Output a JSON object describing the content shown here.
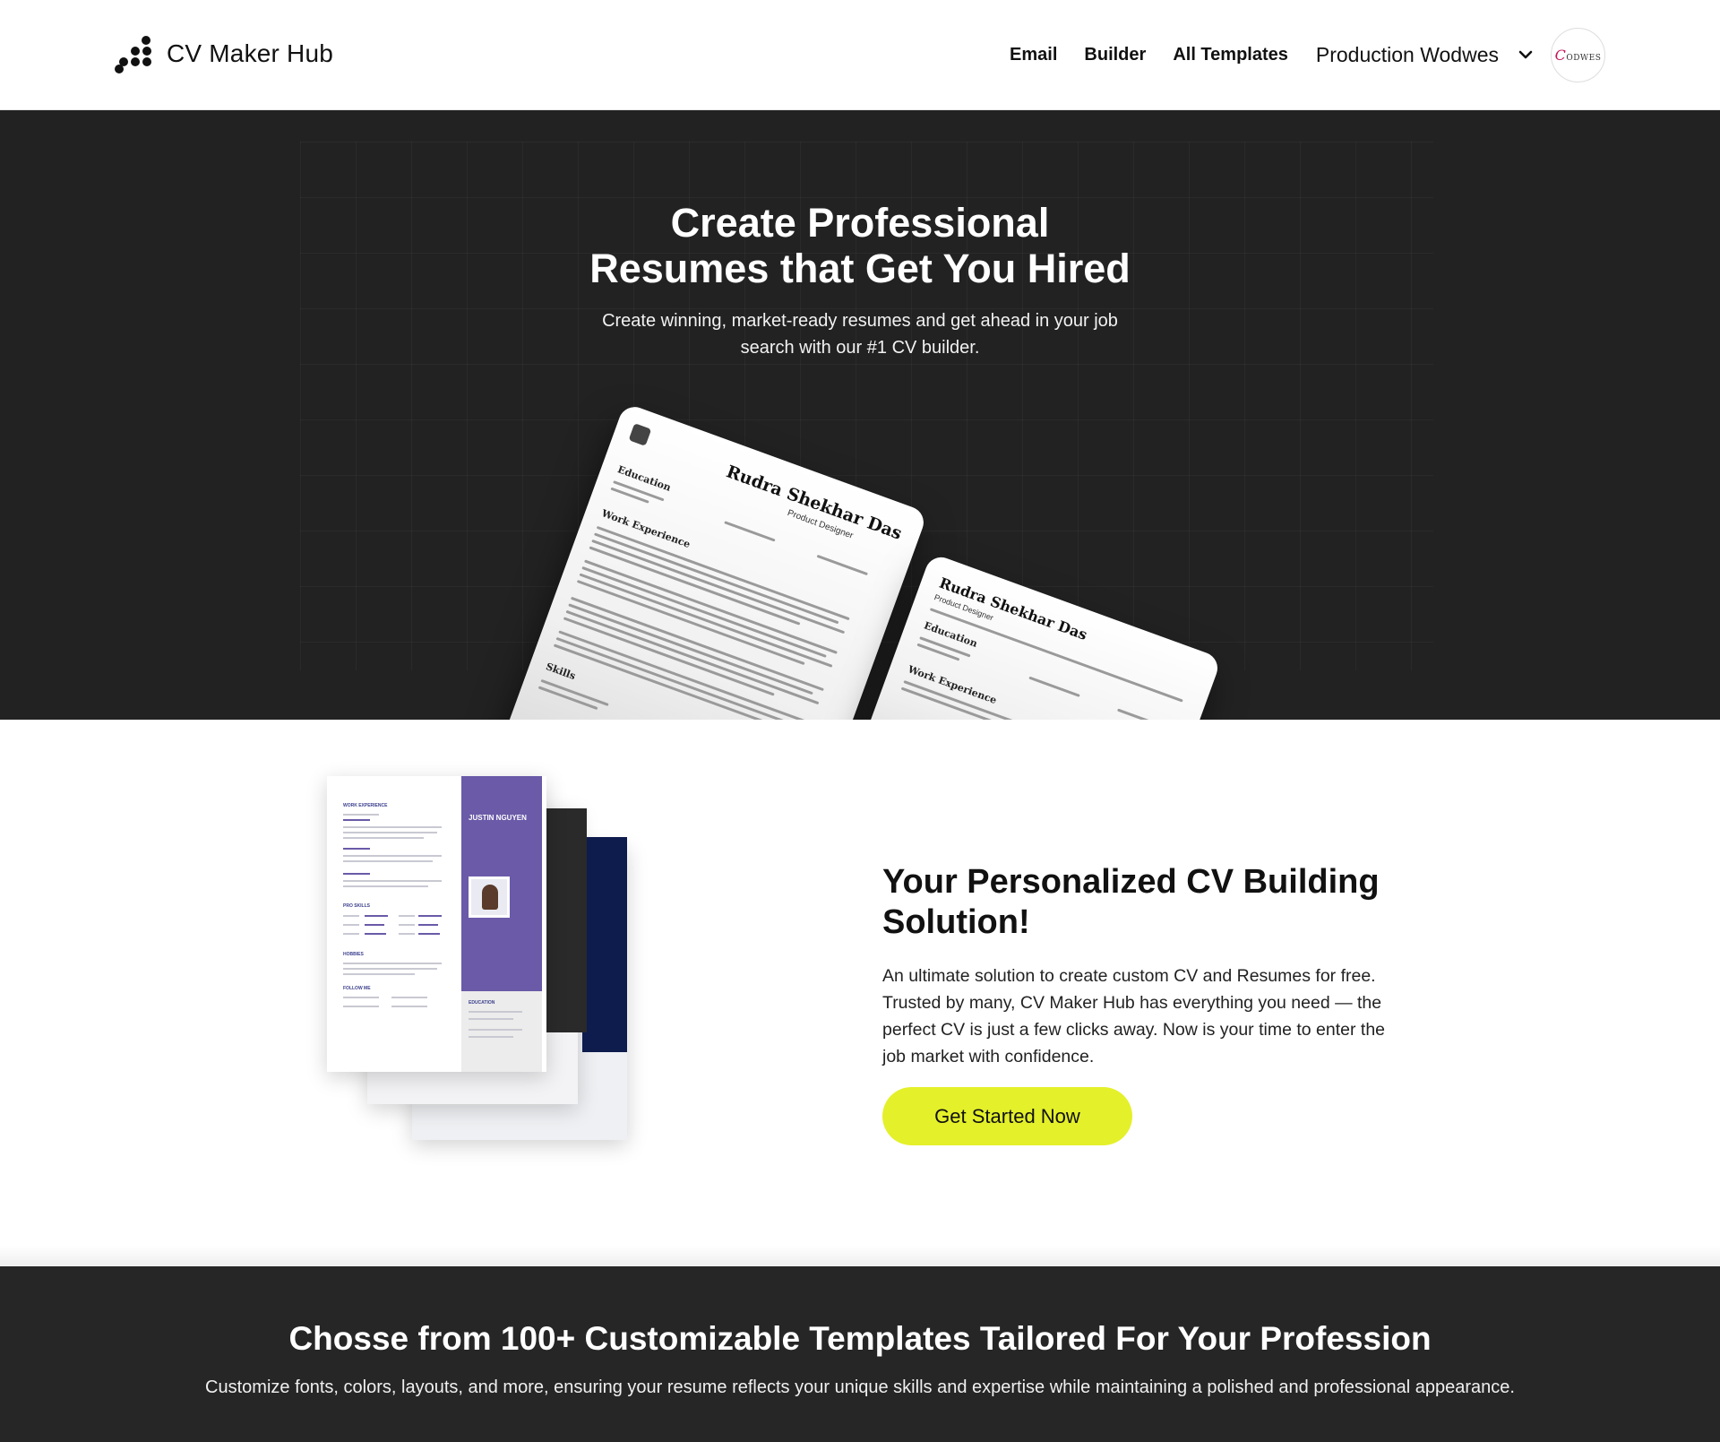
{
  "header": {
    "brand": "CV Maker Hub",
    "nav": [
      "Email",
      "Builder",
      "All Templates"
    ],
    "user_name": "Production Wodwes",
    "avatar_text": "ODWES"
  },
  "hero": {
    "title_line1": "Create Professional",
    "title_line2": "Resumes that Get You Hired",
    "subtitle": "Create winning, market-ready resumes and get ahead in your job search with our #1 CV builder.",
    "resume_preview": {
      "name": "Rudra Shekhar Das",
      "role": "Product Designer",
      "sections": [
        "Education",
        "Work Experience",
        "Skills"
      ]
    }
  },
  "feature": {
    "template_preview": {
      "name": "JUSTIN NGUYEN",
      "sections": [
        "WORK EXPERIENCE",
        "PRO SKILLS",
        "HOBBIES",
        "FOLLOW ME",
        "EDUCATION"
      ]
    },
    "title": "Your Personalized CV Building Solution!",
    "text": "An ultimate solution to create custom CV and Resumes for free. Trusted by many, CV Maker Hub has everything you need — the perfect CV is just a few clicks away. Now is your time to enter the job market with confidence.",
    "cta": "Get Started Now"
  },
  "templates": {
    "title": "Chosse from 100+ Customizable Templates Tailored For Your Profession",
    "subtitle": "Customize fonts, colors, layouts, and more, ensuring your resume reflects your unique skills and expertise while maintaining a polished and professional appearance."
  },
  "colors": {
    "accent": "#e4f02a",
    "hero_bg": "#222222",
    "template_purple": "#6a5aa8"
  }
}
